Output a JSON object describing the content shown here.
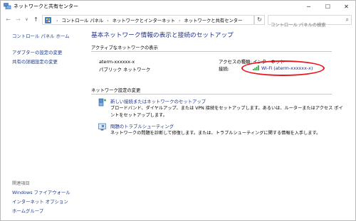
{
  "window": {
    "title": "ネットワークと共有センター",
    "minimize": "─",
    "maximize": "☐",
    "close": "✕"
  },
  "nav": {
    "back": "←",
    "forward": "→",
    "recent": "∨",
    "up": "↑",
    "breadcrumbs": [
      "コントロール パネル",
      "ネットワークとインターネット",
      "ネットワークと共有センター"
    ],
    "separator": "›",
    "dropdown": "∨",
    "refresh": "↻",
    "search_placeholder": "コントロール パネルの検索",
    "search_icon": "⌕"
  },
  "left": {
    "links": [
      "コントロール パネル ホーム",
      "アダプターの設定の変更",
      "共有の詳細設定の変更"
    ],
    "see_also_heading": "関連項目",
    "see_also": [
      "Windows ファイアウォール",
      "インターネット オプション",
      "ホームグループ"
    ]
  },
  "main": {
    "title": "基本ネットワーク情報の表示と接続のセットアップ",
    "active_heading": "アクティブなネットワークの表示",
    "network": {
      "name": "aterm-xxxxxx-x",
      "type": "パブリック ネットワーク",
      "access_label": "アクセスの種類:",
      "access_value": "インターネット",
      "connection_label": "接続:",
      "connection_value": "Wi-Fi (aterm-xxxxxx-x)"
    },
    "change_heading": "ネットワーク設定の変更",
    "tasks": [
      {
        "link": "新しい接続またはネットワークのセットアップ",
        "desc": "ブロードバンド、ダイヤルアップ、または VPN 接続をセットアップします。あるいは、ルーターまたはアクセス ポイントをセットアップします。",
        "icon": "network-setup-icon"
      },
      {
        "link": "問題のトラブルシューティング",
        "desc": "ネットワークの問題を診断して修復します。または、トラブルシューティングに関する情報を入手します。",
        "icon": "troubleshoot-icon"
      }
    ]
  },
  "colors": {
    "link": "#1e3287",
    "highlight": "#e8151c",
    "wifi_signal": "#2f9e3f"
  }
}
